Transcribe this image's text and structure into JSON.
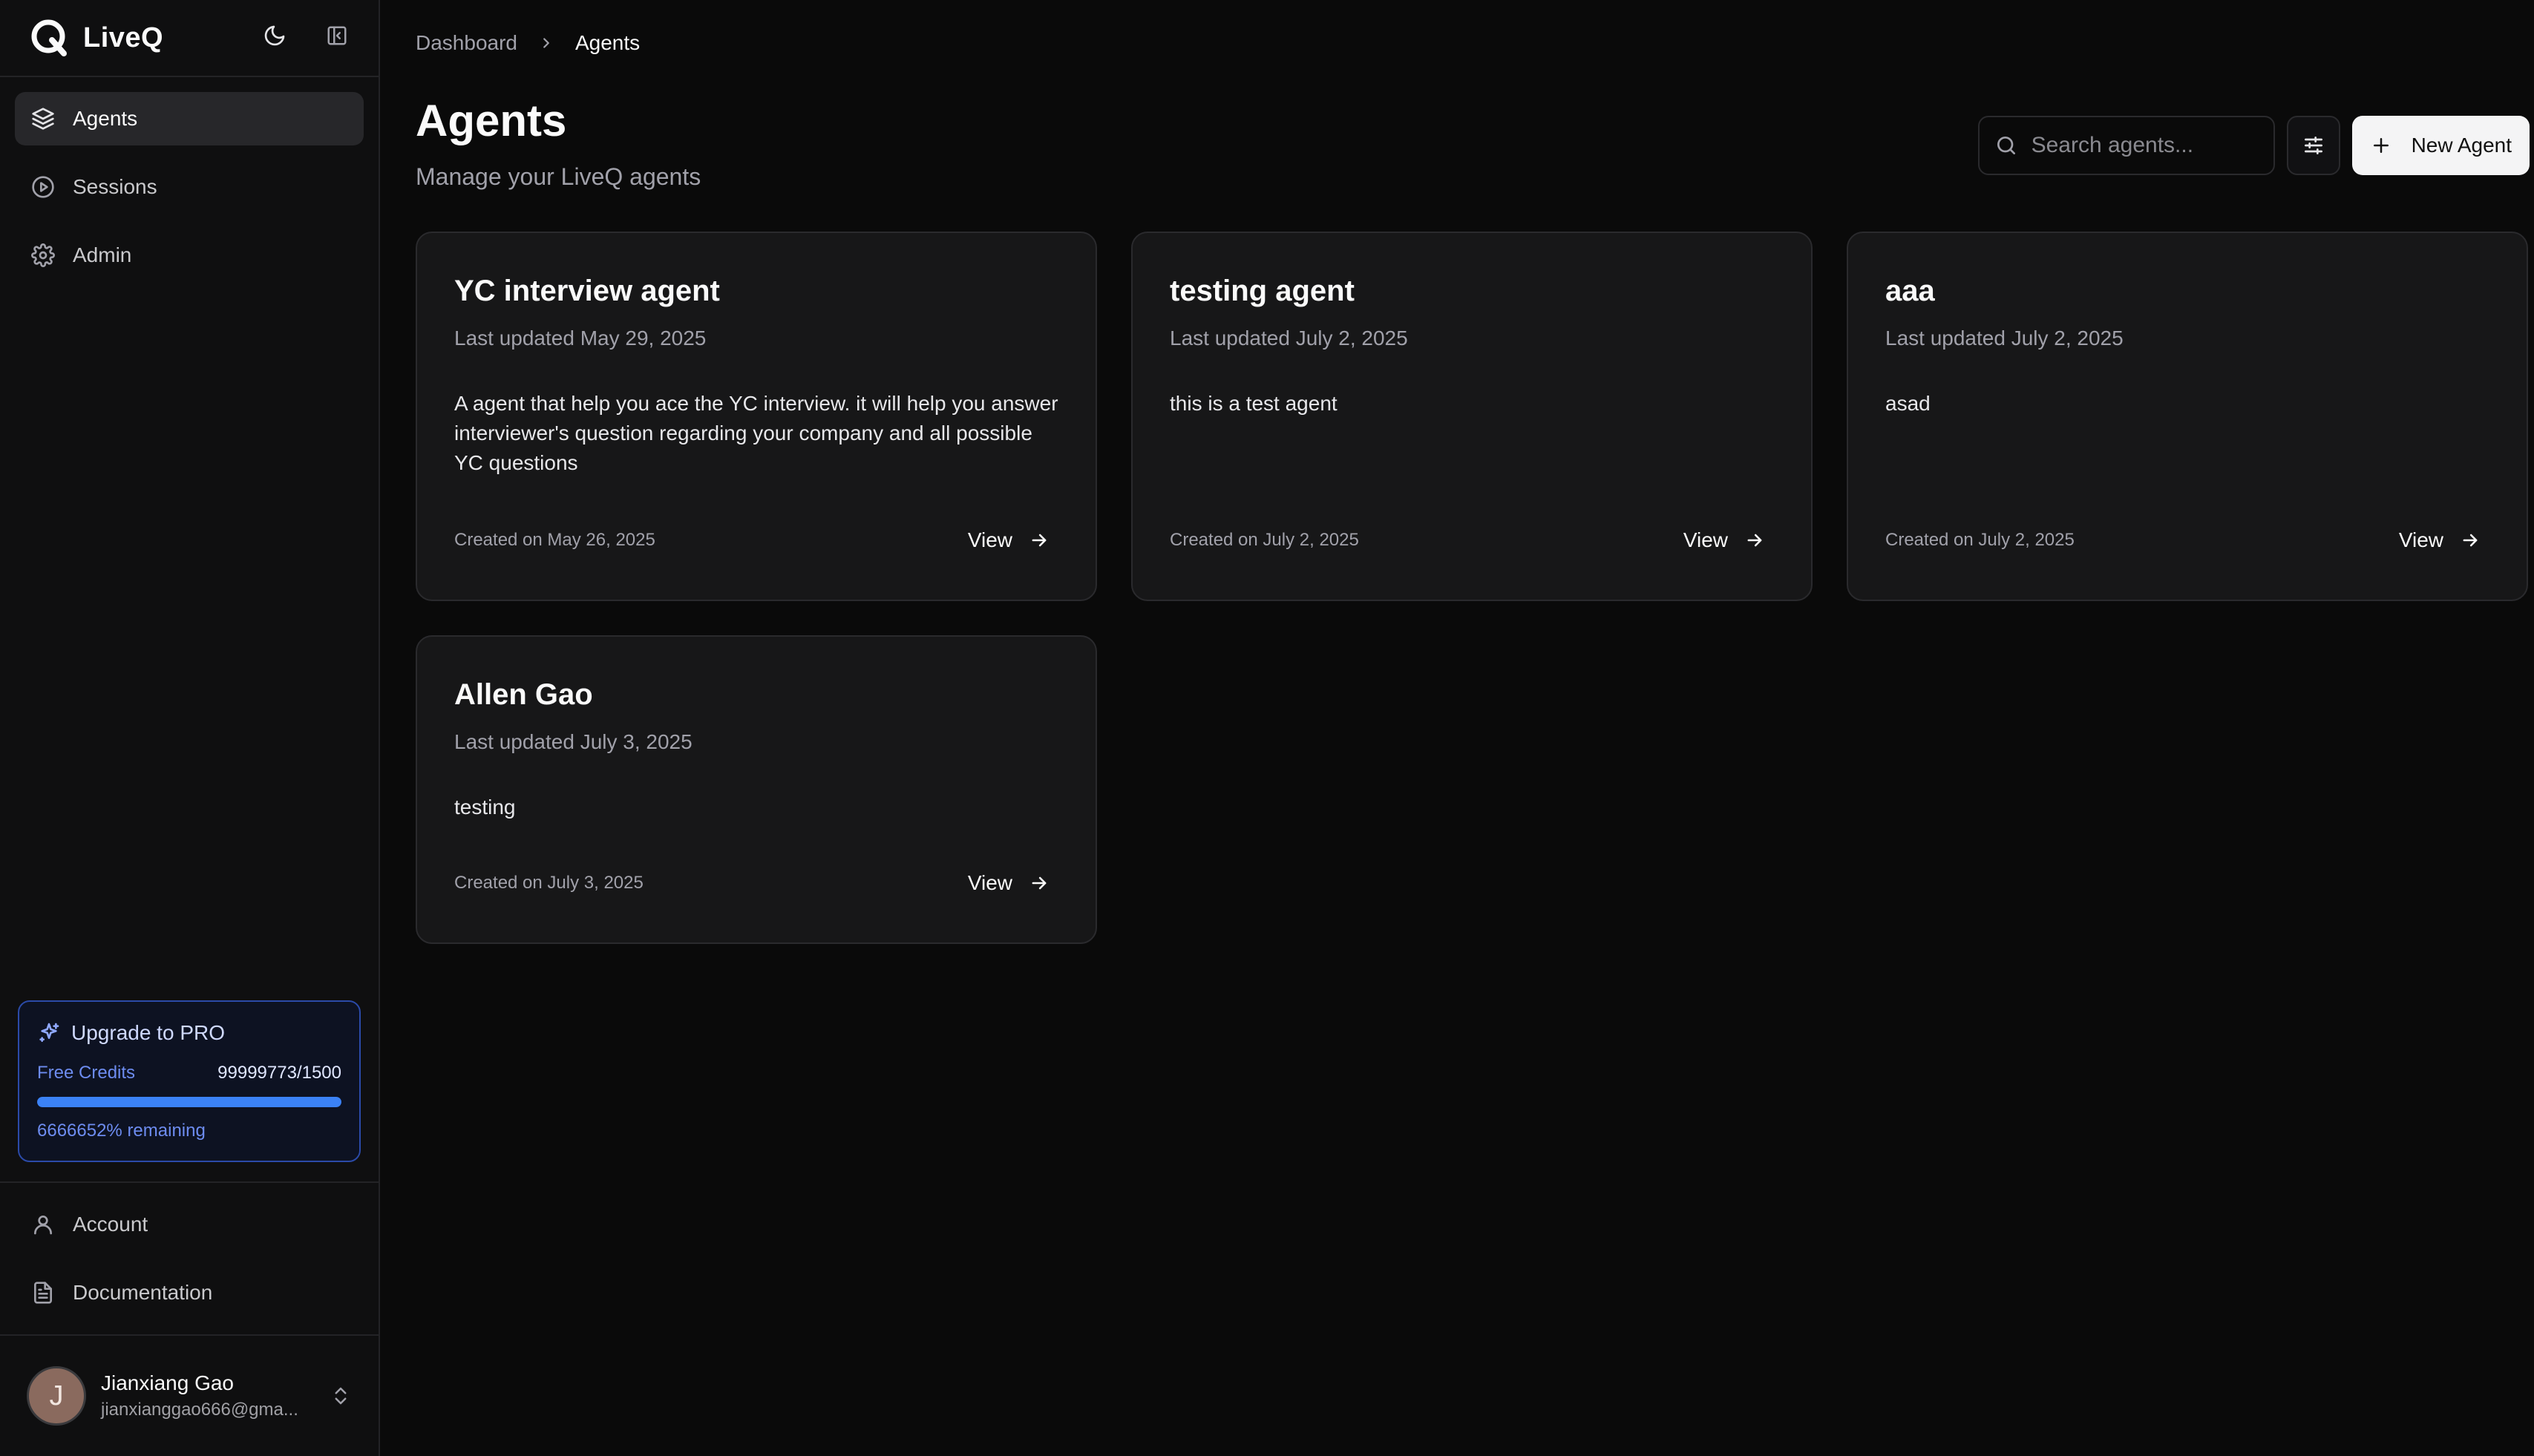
{
  "brand": {
    "name": "LiveQ"
  },
  "sidebar": {
    "items": [
      {
        "label": "Agents",
        "icon": "layers-icon",
        "active": true
      },
      {
        "label": "Sessions",
        "icon": "play-circle-icon",
        "active": false
      },
      {
        "label": "Admin",
        "icon": "gear-icon",
        "active": false
      }
    ],
    "bottom_items": [
      {
        "label": "Account",
        "icon": "user-icon"
      },
      {
        "label": "Documentation",
        "icon": "document-icon"
      }
    ]
  },
  "upgrade": {
    "title": "Upgrade to PRO",
    "credits_label": "Free Credits",
    "credits_value": "99999773/1500",
    "progress_fraction": 1.0,
    "remaining_text": "6666652% remaining"
  },
  "user": {
    "initial": "J",
    "name": "Jianxiang Gao",
    "email": "jianxianggao666@gma..."
  },
  "breadcrumb": {
    "parent": "Dashboard",
    "current": "Agents"
  },
  "page": {
    "title": "Agents",
    "subtitle": "Manage your LiveQ agents"
  },
  "toolbar": {
    "search_placeholder": "Search agents...",
    "new_label": "New Agent"
  },
  "agents": [
    {
      "title": "YC interview agent",
      "updated": "Last updated May 29, 2025",
      "description": "A agent that help you ace the YC interview. it will help you answer interviewer's question regarding your company and all possible YC questions",
      "created": "Created on May 26, 2025",
      "view_label": "View"
    },
    {
      "title": "testing agent",
      "updated": "Last updated July 2, 2025",
      "description": "this is a test agent",
      "created": "Created on July 2, 2025",
      "view_label": "View"
    },
    {
      "title": "aaa",
      "updated": "Last updated July 2, 2025",
      "description": "asad",
      "created": "Created on July 2, 2025",
      "view_label": "View"
    },
    {
      "title": "Allen Gao",
      "updated": "Last updated July 3, 2025",
      "description": "testing",
      "created": "Created on July 3, 2025",
      "view_label": "View"
    }
  ],
  "colors": {
    "background": "#0a0a0a",
    "card": "#171718",
    "accent": "#3b82f6",
    "upgrade_border": "#2b4aa8"
  }
}
